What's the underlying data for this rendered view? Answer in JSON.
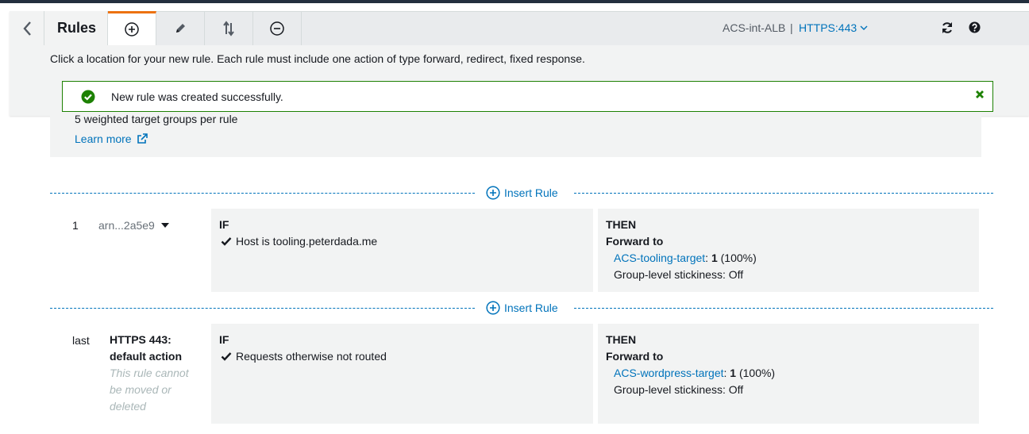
{
  "toolbar": {
    "title": "Rules",
    "load_balancer": "ACS-int-ALB",
    "separator": "|",
    "listener": "HTTPS:443"
  },
  "instruction": "Click a location for your new rule. Each rule must include one action of type forward, redirect, fixed response.",
  "flash": {
    "message": "New rule was created successfully.",
    "color": "#1d8102"
  },
  "info": {
    "text": "5 weighted target groups per rule",
    "learn_more": "Learn more"
  },
  "insert_rule_label": "Insert Rule",
  "rules": [
    {
      "number": "1",
      "arn": "arn...2a5e9",
      "if_label": "IF",
      "condition": "Host is tooling.peterdada.me",
      "then_label": "THEN",
      "action": "Forward to",
      "target": "ACS-tooling-target",
      "target_suffix_colon": ": ",
      "weight": "1",
      "weight_pct": " (100%)",
      "stickiness": "Group-level stickiness: Off"
    },
    {
      "number": "last",
      "name_line1": "HTTPS 443:",
      "name_line2": "default action",
      "note_line1": "This rule cannot",
      "note_line2": "be moved or",
      "note_line3": "deleted",
      "if_label": "IF",
      "condition": "Requests otherwise not routed",
      "then_label": "THEN",
      "action": "Forward to",
      "target": "ACS-wordpress-target",
      "target_suffix_colon": ": ",
      "weight": "1",
      "weight_pct": " (100%)",
      "stickiness": "Group-level stickiness: Off"
    }
  ],
  "colors": {
    "accent_orange": "#ec7211",
    "link_blue": "#0073bb",
    "success_green": "#1d8102"
  }
}
